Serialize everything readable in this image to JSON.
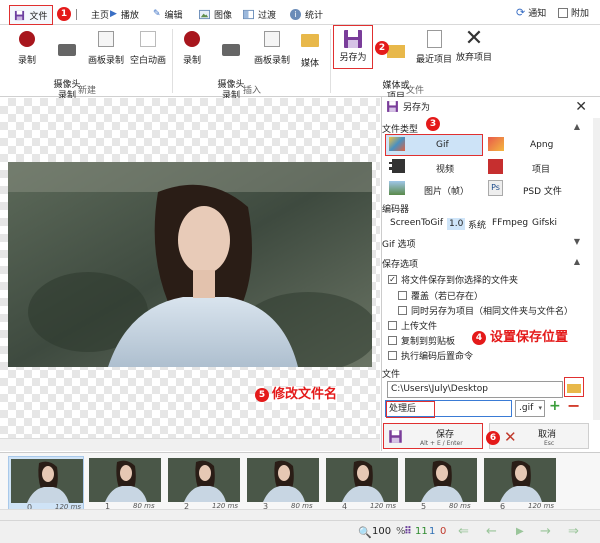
{
  "tabs": [
    {
      "label": "文件",
      "icon": "save-icon"
    },
    {
      "label": "主页",
      "icon": "home-icon"
    },
    {
      "label": "播放",
      "icon": "play-icon"
    },
    {
      "label": "编辑",
      "icon": "pencil-icon"
    },
    {
      "label": "图像",
      "icon": "image-icon"
    },
    {
      "label": "过渡",
      "icon": "transition-icon"
    },
    {
      "label": "统计",
      "icon": "info-icon"
    }
  ],
  "tab_right": {
    "notify": "通知",
    "attach": "附加"
  },
  "ribbon": {
    "new_buttons": [
      "录制",
      "摄像头\n录制",
      "画板录制",
      "空白动画"
    ],
    "new_group": "新建",
    "insert_buttons": [
      "录制",
      "摄像头\n录制",
      "画板录制",
      "媒体"
    ],
    "insert_group": "插入",
    "file_buttons": [
      "另存为",
      "媒体或\n项目",
      "最近项目",
      "放弃项目"
    ],
    "file_group": "文件"
  },
  "panel": {
    "title": "另存为",
    "file_type_label": "文件类型",
    "types": [
      {
        "label": "Gif",
        "selected": true
      },
      {
        "label": "Apng"
      },
      {
        "label": "视频"
      },
      {
        "label": "项目"
      },
      {
        "label": "图片（帧）"
      },
      {
        "label": "PSD 文件"
      }
    ],
    "encoder_label": "编码器",
    "encoders": [
      "ScreenToGif",
      "1.0",
      "系统",
      "FFmpeg",
      "Gifski"
    ],
    "gif_options_label": "Gif 选项",
    "save_options_label": "保存选项",
    "options": [
      {
        "label": "将文件保存到你选择的文件夹",
        "checked": true
      },
      {
        "label": "覆盖（若已存在）",
        "checked": false
      },
      {
        "label": "同时另存为项目（相同文件夹与文件名）",
        "checked": false
      },
      {
        "label": "上传文件",
        "checked": false
      },
      {
        "label": "复制到剪贴板",
        "checked": false
      },
      {
        "label": "执行编码后置命令",
        "checked": false
      }
    ],
    "file_label": "文件",
    "folder_path": "C:\\Users\\July\\Desktop",
    "file_name": "处理后",
    "extension": ".gif",
    "save_button": {
      "label": "保存",
      "shortcut": "Alt + E / Enter"
    },
    "cancel_button": {
      "label": "取消",
      "shortcut": "Esc"
    }
  },
  "annotations": {
    "n1": "1",
    "n2": "2",
    "n3": "3",
    "n4": "4",
    "n5": "5",
    "n6": "6",
    "set_location": "设置保存位置",
    "rename_file": "修改文件名"
  },
  "frames": [
    {
      "num": "0",
      "dur": "120 ms",
      "selected": true
    },
    {
      "num": "1",
      "dur": "80 ms"
    },
    {
      "num": "2",
      "dur": "120 ms"
    },
    {
      "num": "3",
      "dur": "80 ms"
    },
    {
      "num": "4",
      "dur": "120 ms"
    },
    {
      "num": "5",
      "dur": "80 ms"
    },
    {
      "num": "6",
      "dur": "120 ms"
    }
  ],
  "status": {
    "zoom": "100",
    "percent": "%",
    "frames_total": "11",
    "frames_selected": "1",
    "frames_current": "0"
  },
  "colors": {
    "accent": "#e41a1a",
    "selection": "#cde3f7",
    "purple": "#7a3d9a"
  }
}
